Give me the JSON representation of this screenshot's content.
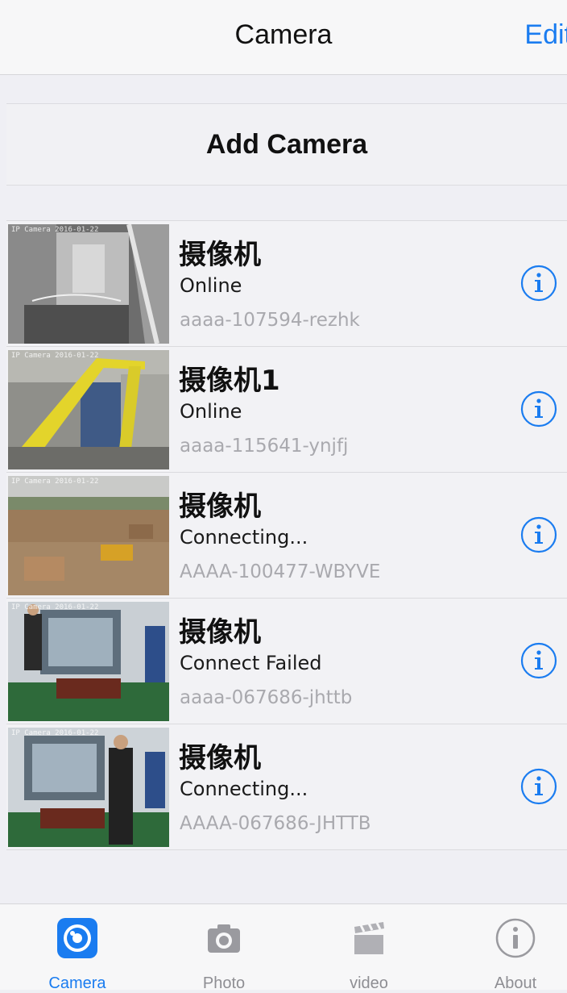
{
  "navbar": {
    "title": "Camera",
    "edit_label": "Edit"
  },
  "add_camera_label": "Add Camera",
  "cameras": [
    {
      "name": "摄像机",
      "status": "Online",
      "id": "aaaa-107594-rezhk"
    },
    {
      "name": "摄像机1",
      "status": "Online",
      "id": "aaaa-115641-ynjfj"
    },
    {
      "name": "摄像机",
      "status": "Connecting...",
      "id": "AAAA-100477-WBYVE"
    },
    {
      "name": "摄像机",
      "status": "Connect Failed",
      "id": "aaaa-067686-jhttb"
    },
    {
      "name": "摄像机",
      "status": "Connecting...",
      "id": "AAAA-067686-JHTTB"
    }
  ],
  "tabs": [
    {
      "label": "Camera",
      "icon": "camera-tab-icon",
      "active": true
    },
    {
      "label": "Photo",
      "icon": "photo-icon",
      "active": false
    },
    {
      "label": "video",
      "icon": "clapperboard-icon",
      "active": false
    },
    {
      "label": "About",
      "icon": "info-icon",
      "active": false
    }
  ],
  "colors": {
    "accent": "#1a7cf0",
    "inactive": "#8e8e93",
    "background": "#efeff4"
  }
}
